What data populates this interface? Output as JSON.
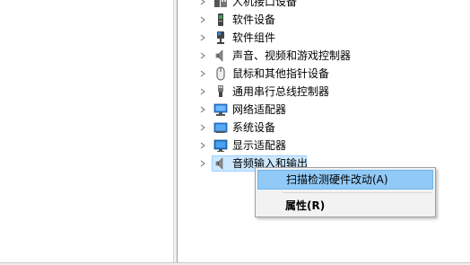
{
  "device_tree": {
    "items": [
      {
        "label": "人机接口设备",
        "icon": "hid-icon",
        "selected": false
      },
      {
        "label": "软件设备",
        "icon": "software-device-icon",
        "selected": false
      },
      {
        "label": "软件组件",
        "icon": "software-component-icon",
        "selected": false
      },
      {
        "label": "声音、视频和游戏控制器",
        "icon": "speaker-icon",
        "selected": false
      },
      {
        "label": "鼠标和其他指针设备",
        "icon": "mouse-icon",
        "selected": false
      },
      {
        "label": "通用串行总线控制器",
        "icon": "usb-icon",
        "selected": false
      },
      {
        "label": "网络适配器",
        "icon": "network-adapter-icon",
        "selected": false
      },
      {
        "label": "系统设备",
        "icon": "system-device-icon",
        "selected": false
      },
      {
        "label": "显示适配器",
        "icon": "display-adapter-icon",
        "selected": false
      },
      {
        "label": "音频输入和输出",
        "icon": "audio-io-icon",
        "selected": true
      }
    ]
  },
  "context_menu": {
    "scan_label": "扫描检测硬件改动(A)",
    "properties_label": "属性(R)"
  },
  "colors": {
    "selection_bg": "#cce8ff",
    "selection_border": "#99d1ff",
    "menu_hover_bg": "#91c9f7",
    "menu_bg": "#f2f2f2"
  }
}
